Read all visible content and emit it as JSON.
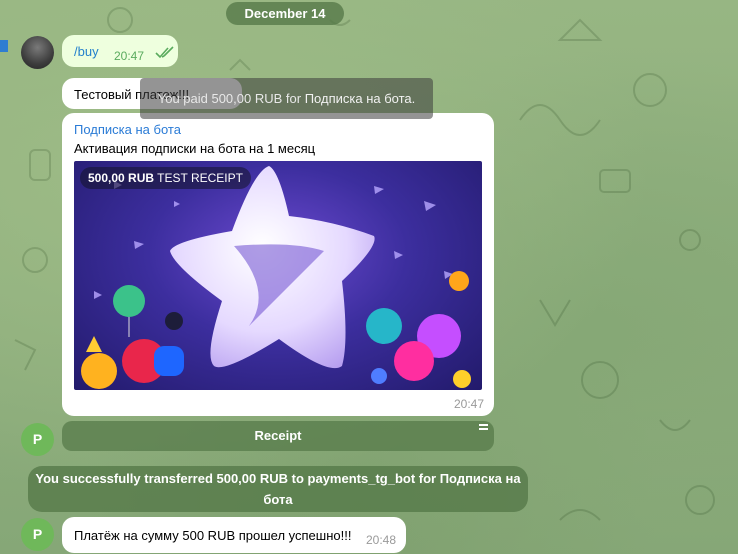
{
  "chat": {
    "date_label": "December 14",
    "user_message": {
      "text": "/buy",
      "time": "20:47"
    },
    "bot_text_message": {
      "text": "Тестовый платеж!!!"
    },
    "invoice": {
      "title": "Подписка на бота",
      "description": "Активация подписки на бота на 1 месяц",
      "amount": "500,00 RUB",
      "receipt_label": "TEST RECEIPT",
      "time": "20:47"
    },
    "toast": {
      "prefix": "You paid 500,00 RUB for ",
      "item": "Подписка на бота."
    },
    "receipt_button": {
      "label": "Receipt"
    },
    "service_message": {
      "text": "You successfully transferred 500,00 RUB to payments_tg_bot for Подписка на бота"
    },
    "final_message": {
      "text": "Платёж на сумму 500 RUB прошел успешно!!!",
      "time": "20:48"
    },
    "bot_avatar_letter": "P"
  },
  "colors": {
    "link": "#2a7bd6",
    "out_bubble": "#eeffde",
    "check": "#5aab5e",
    "pill_bg": "#547848"
  }
}
